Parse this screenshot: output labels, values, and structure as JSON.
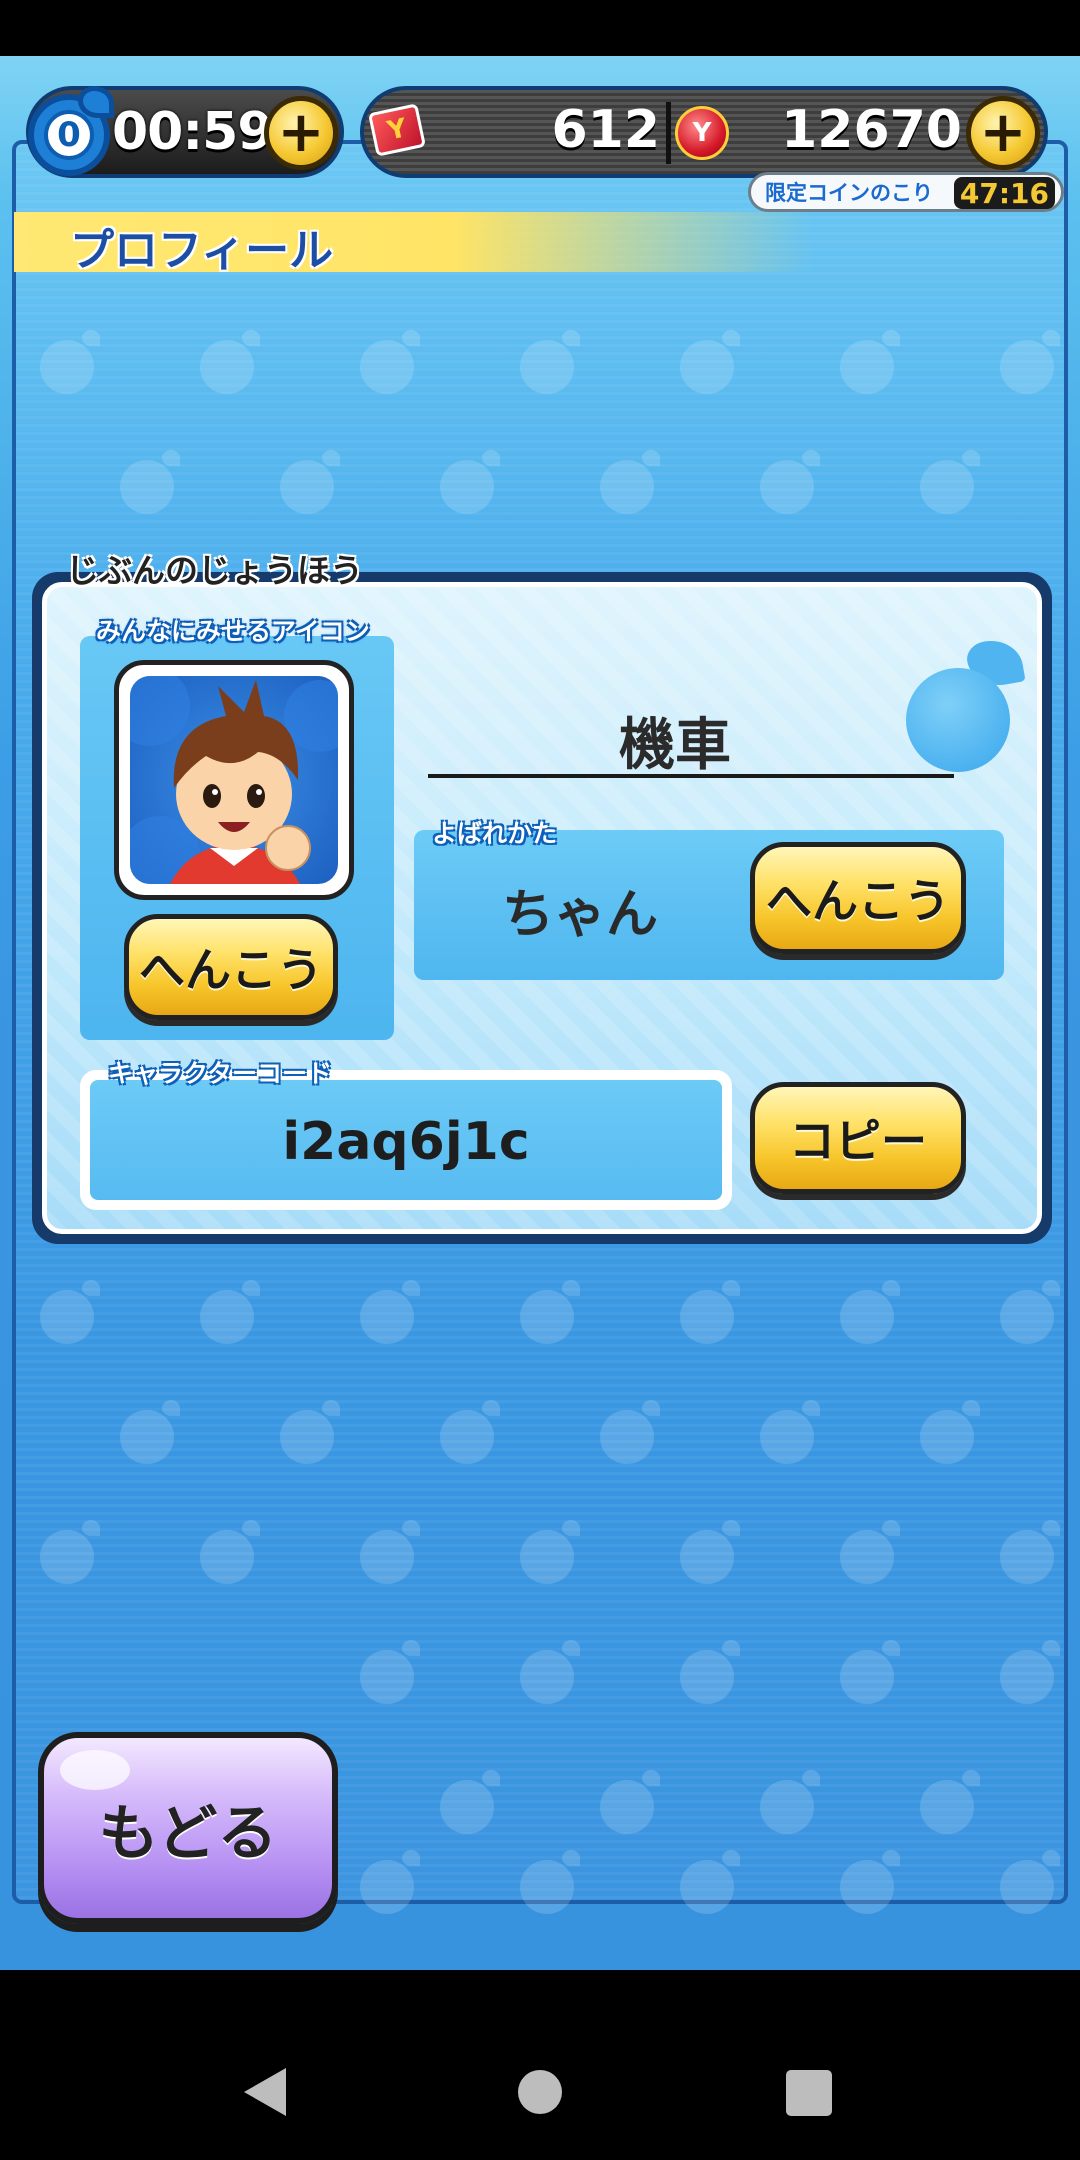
{
  "hud": {
    "stamina_count": "0",
    "timer": "00:59",
    "plus_label": "+",
    "ticket_icon_letter": "Y",
    "ticket_count": "612",
    "coin_icon_letter": "Y",
    "coin_count": "12670",
    "limited_coin_label": "限定コインのこり",
    "limited_coin_time": "47:16"
  },
  "screen": {
    "title": "プロフィール"
  },
  "profile": {
    "section_label": "じぶんのじょうほう",
    "icon_label": "みんなにみせるアイコン",
    "change_icon_label": "へんこう",
    "name": "機車",
    "called_label": "よばれかた",
    "called_value": "ちゃん",
    "change_called_label": "へんこう",
    "code_label": "キャラクターコード",
    "code_value": "i2aq6j1c",
    "copy_label": "コピー"
  },
  "footer": {
    "back_label": "もどる"
  },
  "colors": {
    "sky_blue": "#4aacec",
    "banner_yellow": "#ffe873",
    "button_yellow": "#f7c52a",
    "back_purple": "#b792f3",
    "title_blue": "#1c4fa3"
  },
  "icons": {
    "stamina": "watch-drop-icon",
    "ticket": "ticket-icon",
    "coin": "coin-purse-icon",
    "nav_back": "nav-back-icon",
    "nav_home": "nav-home-icon",
    "nav_recent": "nav-recent-icon"
  }
}
